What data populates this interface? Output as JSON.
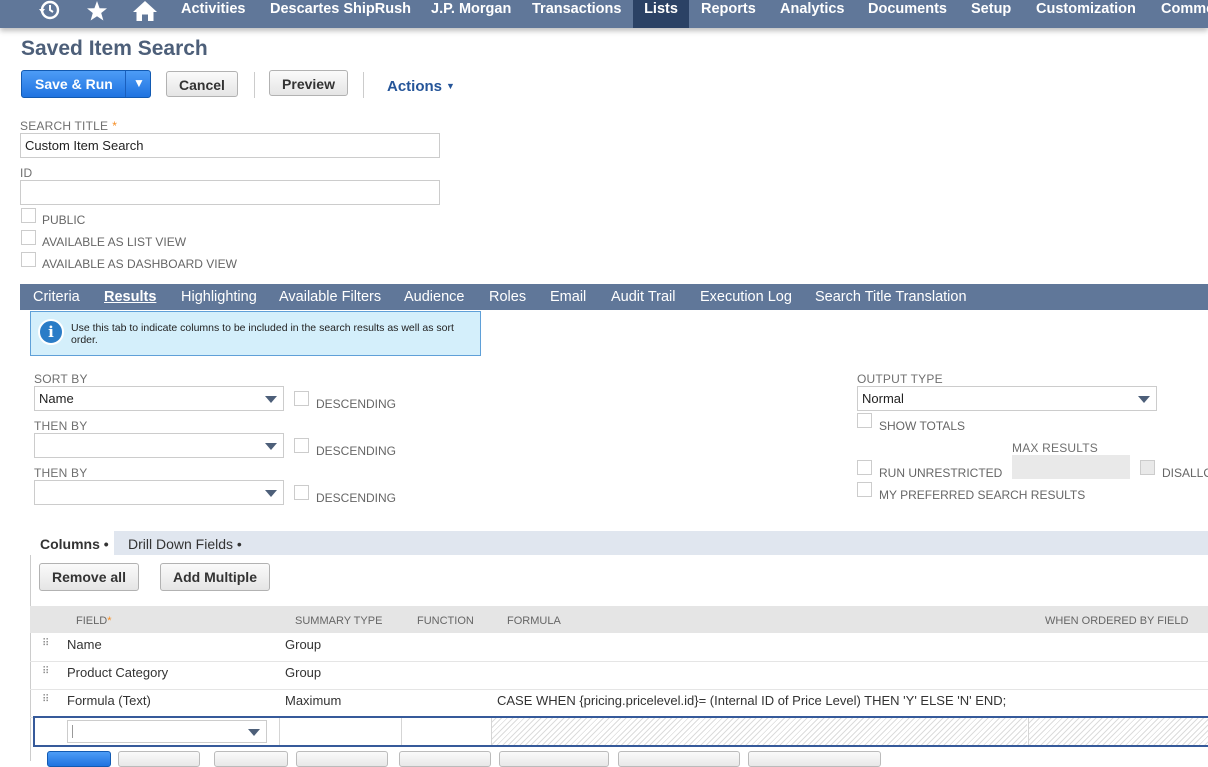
{
  "nav": {
    "icons": [
      "history-icon",
      "star-icon",
      "home-icon"
    ],
    "items": [
      "Activities",
      "Descartes ShipRush",
      "J.P. Morgan",
      "Transactions",
      "Lists",
      "Reports",
      "Analytics",
      "Documents",
      "Setup",
      "Customization",
      "Comme"
    ],
    "active": "Lists"
  },
  "page": {
    "title": "Saved Item Search"
  },
  "toolbar": {
    "save_run": "Save & Run",
    "cancel": "Cancel",
    "preview": "Preview",
    "actions": "Actions"
  },
  "form": {
    "search_title_label": "SEARCH TITLE",
    "search_title_required": "*",
    "search_title_value": "Custom Item Search",
    "id_label": "ID",
    "id_value": "",
    "public_label": "PUBLIC",
    "list_view_label": "AVAILABLE AS LIST VIEW",
    "dashboard_view_label": "AVAILABLE AS DASHBOARD VIEW"
  },
  "tabs": [
    "Criteria",
    "Results",
    "Highlighting",
    "Available Filters",
    "Audience",
    "Roles",
    "Email",
    "Audit Trail",
    "Execution Log",
    "Search Title Translation"
  ],
  "active_tab": "Results",
  "info": {
    "text": "Use this tab to indicate columns to be included in the search results as well as sort order."
  },
  "results": {
    "sort_by_label": "SORT BY",
    "sort_by_value": "Name",
    "then_by_1_label": "THEN BY",
    "then_by_1_value": "",
    "then_by_2_label": "THEN BY",
    "then_by_2_value": "",
    "descending_label": "DESCENDING",
    "output_type_label": "OUTPUT TYPE",
    "output_type_value": "Normal",
    "show_totals_label": "SHOW TOTALS",
    "max_results_label": "MAX RESULTS",
    "run_unrestricted_label": "RUN UNRESTRICTED",
    "disallow_label": "DISALLO",
    "preferred_label": "MY PREFERRED SEARCH RESULTS"
  },
  "subtabs": {
    "columns": "Columns •",
    "drill_down": "Drill Down Fields •",
    "remove_all": "Remove all",
    "add_multiple": "Add Multiple"
  },
  "grid": {
    "headers": {
      "field": "FIELD",
      "field_required": "*",
      "summary_type": "SUMMARY TYPE",
      "function": "FUNCTION",
      "formula": "FORMULA",
      "when_ordered": "WHEN ORDERED BY FIELD"
    },
    "rows": [
      {
        "field": "Name",
        "summary_type": "Group",
        "function": "",
        "formula": ""
      },
      {
        "field": "Product Category",
        "summary_type": "Group",
        "function": "",
        "formula": ""
      },
      {
        "field": "Formula (Text)",
        "summary_type": "Maximum",
        "function": "",
        "formula": "CASE WHEN {pricing.pricelevel.id}= (Internal ID of Price Level) THEN 'Y' ELSE 'N' END;"
      }
    ]
  }
}
